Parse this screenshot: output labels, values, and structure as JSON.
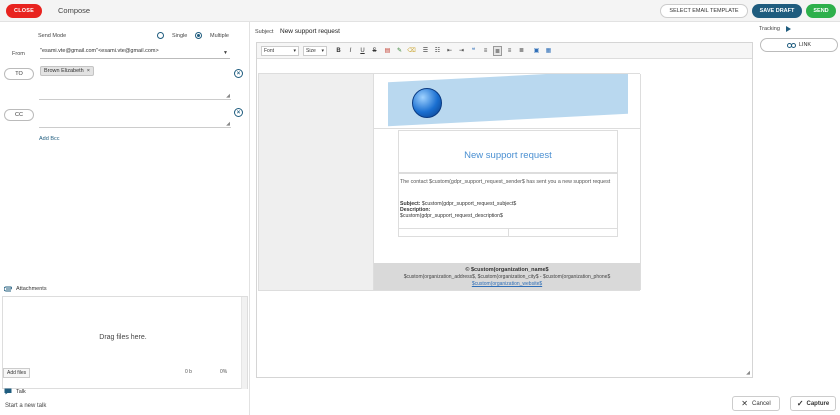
{
  "header": {
    "close_label": "CLOSE",
    "title": "Compose",
    "template_label": "SELECT EMAIL TEMPLATE",
    "draft_label": "SAVE DRAFT",
    "send_label": "SEND"
  },
  "send_mode": {
    "label": "Send Mode",
    "options": [
      "Single",
      "Multiple"
    ],
    "selected": "Multiple"
  },
  "from": {
    "label": "From",
    "value": "\"esami.vte@gmail.com\"<esami.vte@gmail.com>"
  },
  "to": {
    "label": "TO",
    "recipients": [
      "Brown Elizabeth"
    ]
  },
  "cc": {
    "label": "CC"
  },
  "add_bcc": "Add Bcc",
  "attachments": {
    "label": "Attachments",
    "drop_text": "Drag files here.",
    "add_files": "Add files",
    "total_size": "0 b",
    "progress": "0%"
  },
  "talk": {
    "label": "Talk",
    "placeholder": "Start a new talk"
  },
  "subject": {
    "label": "Subject",
    "value": "New support request"
  },
  "toolbar": {
    "font_label": "Font",
    "size_label": "Size",
    "buttons": [
      "B",
      "I",
      "U",
      "S"
    ]
  },
  "email": {
    "title": "New support request",
    "body": "The contact $custom(gdpr_support_request_sender$ has sent you a new support request",
    "subject_label": "Subject:",
    "subject_value": "$custom(gdpr_support_request_subject$",
    "description_label": "Description:",
    "description_value": "$custom(gdpr_support_request_description$",
    "footer_org": "© $custom(organization_name$",
    "footer_addr": "$custom(organization_address$, $custom(organization_city$ - $custom(organization_phone$",
    "footer_web": "$custom(organization_website$"
  },
  "tracking": {
    "label": "Tracking",
    "link_label": "LINK"
  },
  "footer_buttons": {
    "cancel": "Cancel",
    "capture": "Capture"
  },
  "colors": {
    "close": "#e8231f",
    "draft": "#1f5c7e",
    "send": "#2db04b",
    "email_title": "#4a8fd1"
  }
}
